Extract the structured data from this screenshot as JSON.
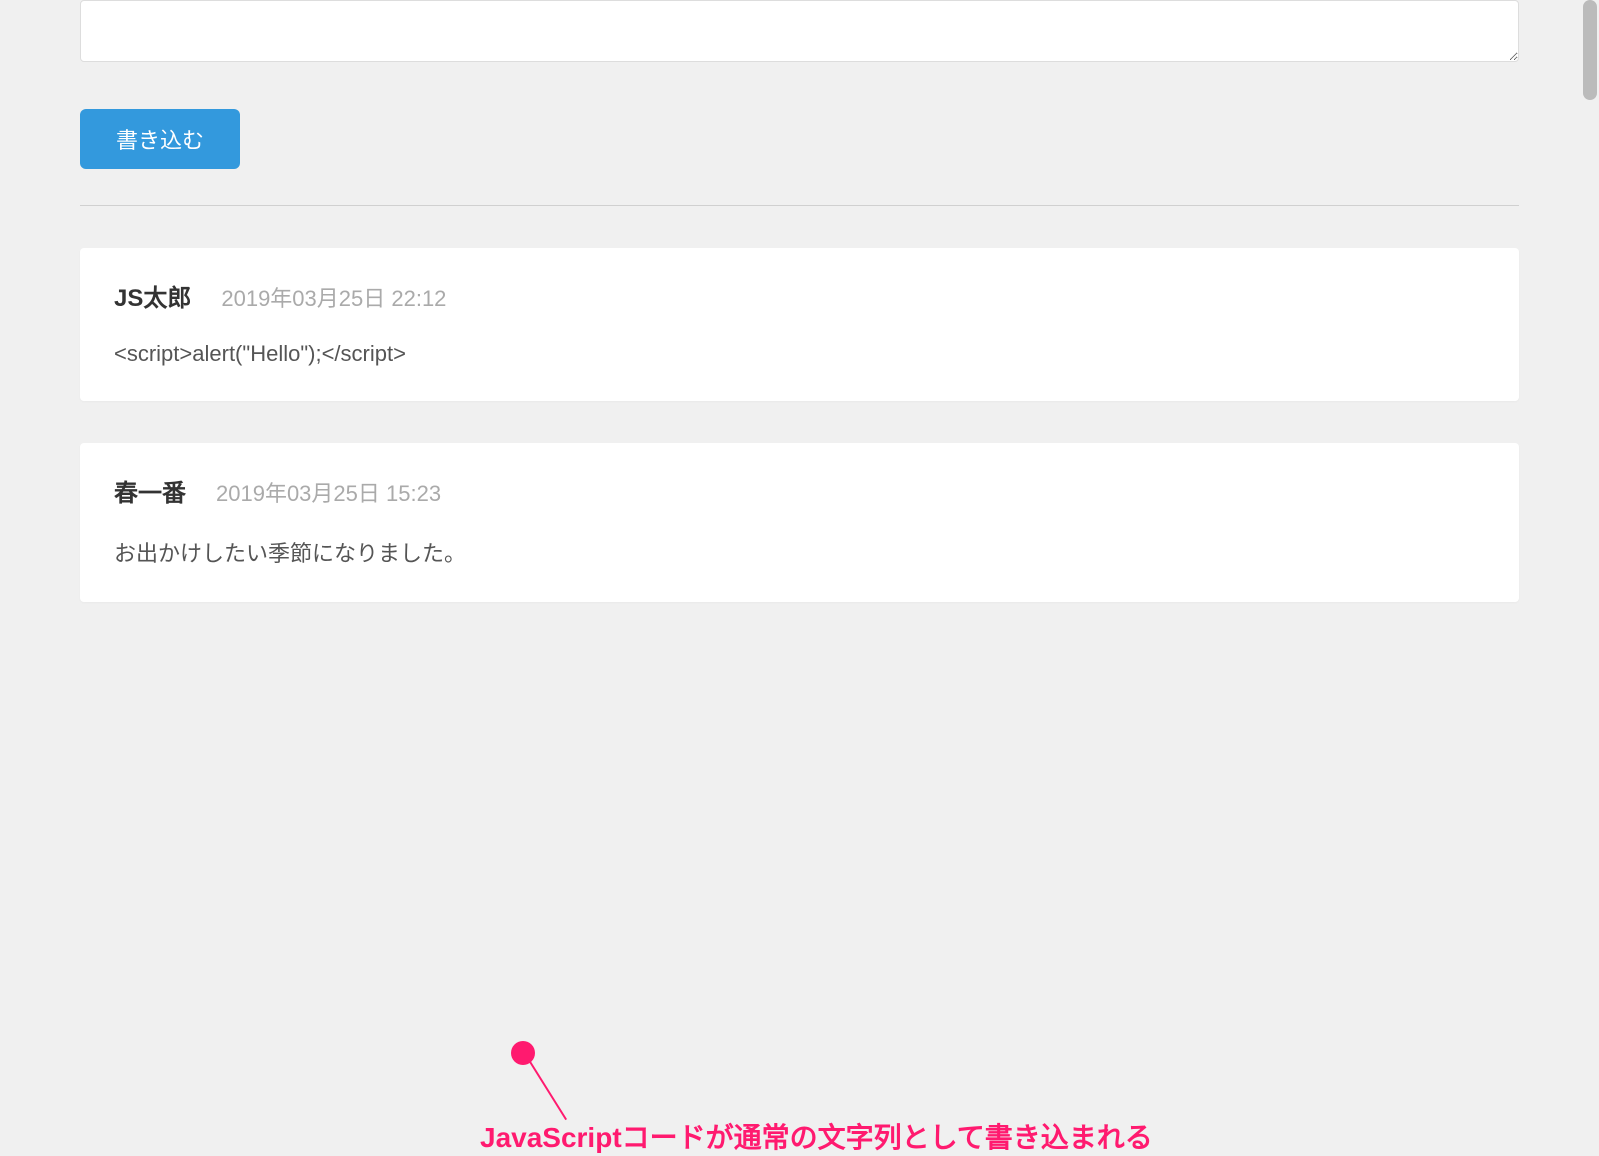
{
  "form": {
    "textarea_value": "",
    "submit_label": "書き込む"
  },
  "posts": [
    {
      "author": "JS太郎",
      "timestamp": "2019年03月25日 22:12",
      "body": "<script>alert(\"Hello\");</script>"
    },
    {
      "author": "春一番",
      "timestamp": "2019年03月25日 15:23",
      "body": "お出かけしたい季節になりました。"
    }
  ],
  "annotation": {
    "text": "JavaScriptコードが通常の文字列として書き込まれる",
    "color": "#ff1a6f"
  }
}
